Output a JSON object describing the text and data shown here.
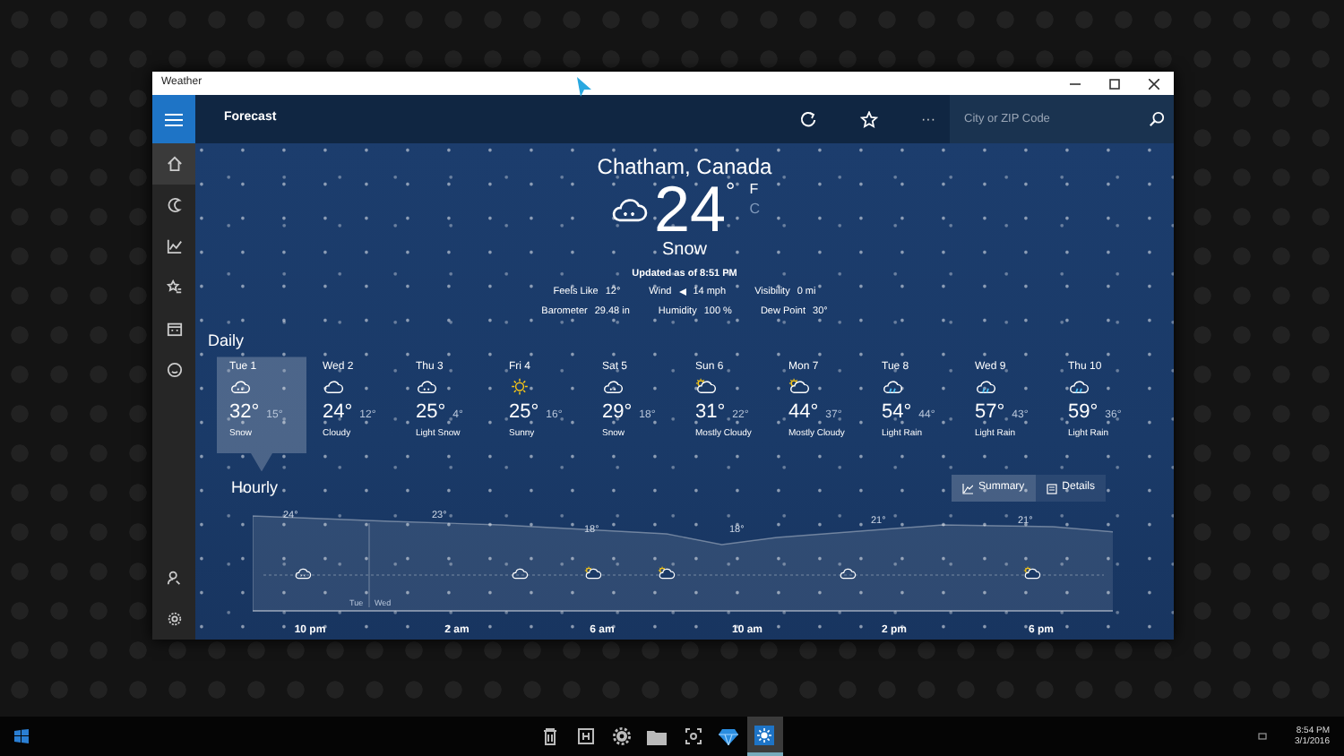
{
  "window": {
    "title": "Weather"
  },
  "app_bar": {
    "title": "Forecast",
    "search": {
      "placeholder": "City or ZIP Code"
    },
    "more": "···"
  },
  "nav": {
    "items": [
      {
        "kind": "home",
        "selected": true
      },
      {
        "kind": "news",
        "selected": false
      },
      {
        "kind": "maps",
        "selected": false
      },
      {
        "kind": "places",
        "selected": false
      },
      {
        "kind": "calendar",
        "selected": false
      },
      {
        "kind": "face",
        "selected": false
      }
    ],
    "bottom": [
      {
        "kind": "person"
      },
      {
        "kind": "settings"
      }
    ]
  },
  "current": {
    "location": "Chatham, Canada",
    "temperature": "24",
    "degree": "°",
    "units": [
      {
        "label": "F",
        "selected": true
      },
      {
        "label": "C",
        "selected": false
      }
    ],
    "condition": "Snow",
    "updated": "Updated as of 8:51 PM",
    "details": [
      [
        {
          "label": "Feels Like",
          "value": "12°"
        },
        {
          "label": "Wind",
          "value": "14 mph",
          "arrow": true
        },
        {
          "label": "Visibility",
          "value": "0 mi"
        }
      ],
      [
        {
          "label": "Barometer",
          "value": "29.48 in"
        },
        {
          "label": "Humidity",
          "value": "100 %"
        },
        {
          "label": "Dew Point",
          "value": "30°"
        }
      ]
    ]
  },
  "daily": {
    "title": "Daily",
    "days": [
      {
        "day": "Tue 1",
        "kind": "snow",
        "high": "32°",
        "low": "15°",
        "condition": "Snow",
        "selected": true
      },
      {
        "day": "Wed 2",
        "kind": "cloud",
        "high": "24°",
        "low": "12°",
        "condition": "Cloudy",
        "selected": false
      },
      {
        "day": "Thu 3",
        "kind": "snow",
        "high": "25°",
        "low": "4°",
        "condition": "Light Snow",
        "selected": false
      },
      {
        "day": "Fri 4",
        "kind": "sun",
        "high": "25°",
        "low": "16°",
        "condition": "Sunny",
        "selected": false
      },
      {
        "day": "Sat 5",
        "kind": "snow",
        "high": "29°",
        "low": "18°",
        "condition": "Snow",
        "selected": false
      },
      {
        "day": "Sun 6",
        "kind": "partsun",
        "high": "31°",
        "low": "22°",
        "condition": "Mostly Cloudy",
        "selected": false
      },
      {
        "day": "Mon 7",
        "kind": "partsun",
        "high": "44°",
        "low": "37°",
        "condition": "Mostly Cloudy",
        "selected": false
      },
      {
        "day": "Tue 8",
        "kind": "rain",
        "high": "54°",
        "low": "44°",
        "condition": "Light Rain",
        "selected": false
      },
      {
        "day": "Wed 9",
        "kind": "rain",
        "high": "57°",
        "low": "43°",
        "condition": "Light Rain",
        "selected": false
      },
      {
        "day": "Thu 10",
        "kind": "rain",
        "high": "59°",
        "low": "36°",
        "condition": "Light Rain",
        "selected": false
      }
    ]
  },
  "hourly": {
    "title": "Hourly",
    "views": [
      {
        "label": "Summary",
        "kind": "chart",
        "selected": true
      },
      {
        "label": "Details",
        "kind": "list",
        "selected": false
      }
    ],
    "temperature_labels": [
      "24°",
      "23°",
      "18°",
      "18°",
      "21°",
      "21°"
    ],
    "day_labels": [
      "Tue",
      "Wed"
    ],
    "icons": [
      {
        "kind": "snow"
      },
      {
        "kind": "cloud"
      },
      {
        "kind": "partsun"
      },
      {
        "kind": "partsun"
      },
      {
        "kind": "cloud"
      },
      {
        "kind": "partsun"
      }
    ],
    "times": [
      "10 pm",
      "2 am",
      "6 am",
      "10 am",
      "2 pm",
      "6 pm"
    ]
  },
  "taskbar": {
    "apps": [
      {
        "kind": "trash",
        "selected": false
      },
      {
        "kind": "box",
        "selected": false
      },
      {
        "kind": "gear",
        "selected": false
      },
      {
        "kind": "folder",
        "selected": false
      },
      {
        "kind": "frame",
        "selected": false
      },
      {
        "kind": "gem",
        "selected": false
      },
      {
        "kind": "weather",
        "selected": true
      }
    ],
    "time": "8:54 PM",
    "date": "3/1/2016"
  }
}
